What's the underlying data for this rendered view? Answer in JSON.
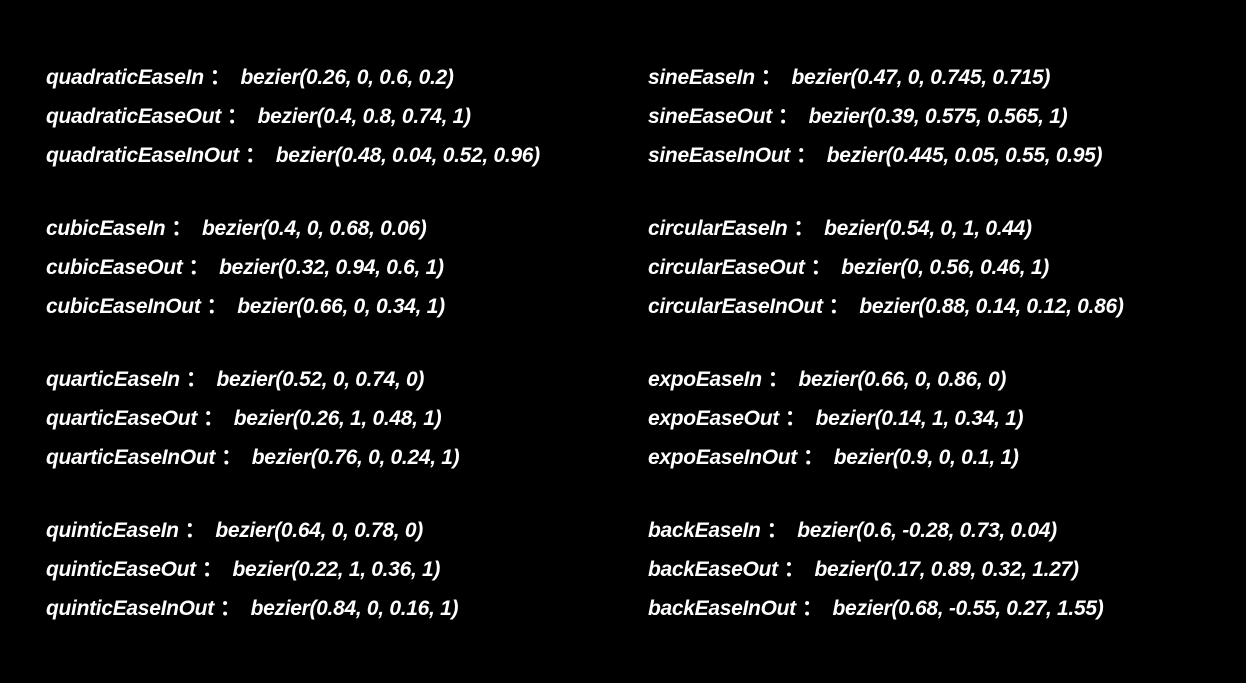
{
  "columns": [
    {
      "groups": [
        {
          "items": [
            {
              "name": "quadraticEaseIn",
              "value": "bezier(0.26, 0, 0.6, 0.2)"
            },
            {
              "name": "quadraticEaseOut",
              "value": "bezier(0.4, 0.8, 0.74, 1)"
            },
            {
              "name": "quadraticEaseInOut",
              "value": "bezier(0.48, 0.04, 0.52, 0.96)"
            }
          ]
        },
        {
          "items": [
            {
              "name": "cubicEaseIn",
              "value": "bezier(0.4, 0, 0.68, 0.06)"
            },
            {
              "name": "cubicEaseOut",
              "value": "bezier(0.32, 0.94, 0.6, 1)"
            },
            {
              "name": "cubicEaseInOut",
              "value": "bezier(0.66, 0, 0.34, 1)"
            }
          ]
        },
        {
          "items": [
            {
              "name": "quarticEaseIn",
              "value": "bezier(0.52, 0, 0.74, 0)"
            },
            {
              "name": "quarticEaseOut",
              "value": "bezier(0.26, 1, 0.48, 1)"
            },
            {
              "name": "quarticEaseInOut",
              "value": "bezier(0.76, 0, 0.24, 1)"
            }
          ]
        },
        {
          "items": [
            {
              "name": "quinticEaseIn",
              "value": "bezier(0.64, 0, 0.78, 0)"
            },
            {
              "name": "quinticEaseOut",
              "value": "bezier(0.22, 1, 0.36, 1)"
            },
            {
              "name": "quinticEaseInOut",
              "value": "bezier(0.84, 0, 0.16, 1)"
            }
          ]
        }
      ]
    },
    {
      "groups": [
        {
          "items": [
            {
              "name": "sineEaseIn",
              "value": "bezier(0.47, 0, 0.745, 0.715)"
            },
            {
              "name": "sineEaseOut",
              "value": "bezier(0.39, 0.575, 0.565, 1)"
            },
            {
              "name": "sineEaseInOut",
              "value": "bezier(0.445, 0.05, 0.55, 0.95)"
            }
          ]
        },
        {
          "items": [
            {
              "name": "circularEaseIn",
              "value": "bezier(0.54, 0, 1, 0.44)"
            },
            {
              "name": "circularEaseOut",
              "value": "bezier(0, 0.56, 0.46, 1)"
            },
            {
              "name": "circularEaseInOut",
              "value": "bezier(0.88, 0.14, 0.12, 0.86)"
            }
          ]
        },
        {
          "items": [
            {
              "name": "expoEaseIn",
              "value": "bezier(0.66, 0, 0.86, 0)"
            },
            {
              "name": "expoEaseOut",
              "value": "bezier(0.14, 1, 0.34, 1)"
            },
            {
              "name": "expoEaseInOut",
              "value": "bezier(0.9, 0, 0.1, 1)"
            }
          ]
        },
        {
          "items": [
            {
              "name": "backEaseIn",
              "value": "bezier(0.6, -0.28, 0.73, 0.04)"
            },
            {
              "name": "backEaseOut",
              "value": "bezier(0.17, 0.89, 0.32, 1.27)"
            },
            {
              "name": "backEaseInOut",
              "value": "bezier(0.68, -0.55, 0.27, 1.55)"
            }
          ]
        }
      ]
    }
  ],
  "separator": "："
}
